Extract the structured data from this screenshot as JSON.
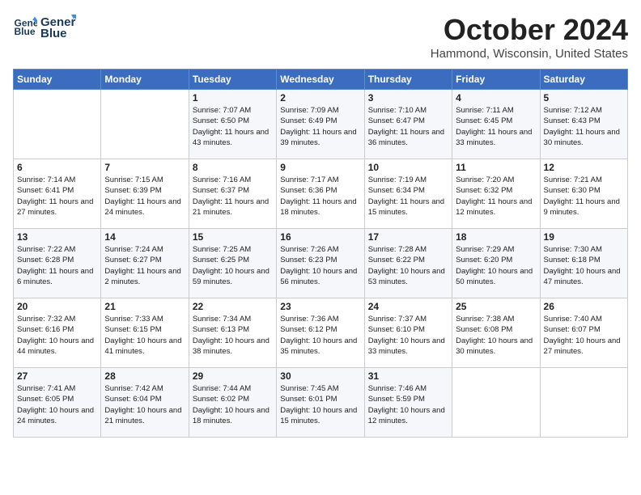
{
  "logo": {
    "line1": "General",
    "line2": "Blue"
  },
  "title": "October 2024",
  "location": "Hammond, Wisconsin, United States",
  "days_header": [
    "Sunday",
    "Monday",
    "Tuesday",
    "Wednesday",
    "Thursday",
    "Friday",
    "Saturday"
  ],
  "weeks": [
    [
      {
        "day": "",
        "sunrise": "",
        "sunset": "",
        "daylight": ""
      },
      {
        "day": "",
        "sunrise": "",
        "sunset": "",
        "daylight": ""
      },
      {
        "day": "1",
        "sunrise": "Sunrise: 7:07 AM",
        "sunset": "Sunset: 6:50 PM",
        "daylight": "Daylight: 11 hours and 43 minutes."
      },
      {
        "day": "2",
        "sunrise": "Sunrise: 7:09 AM",
        "sunset": "Sunset: 6:49 PM",
        "daylight": "Daylight: 11 hours and 39 minutes."
      },
      {
        "day": "3",
        "sunrise": "Sunrise: 7:10 AM",
        "sunset": "Sunset: 6:47 PM",
        "daylight": "Daylight: 11 hours and 36 minutes."
      },
      {
        "day": "4",
        "sunrise": "Sunrise: 7:11 AM",
        "sunset": "Sunset: 6:45 PM",
        "daylight": "Daylight: 11 hours and 33 minutes."
      },
      {
        "day": "5",
        "sunrise": "Sunrise: 7:12 AM",
        "sunset": "Sunset: 6:43 PM",
        "daylight": "Daylight: 11 hours and 30 minutes."
      }
    ],
    [
      {
        "day": "6",
        "sunrise": "Sunrise: 7:14 AM",
        "sunset": "Sunset: 6:41 PM",
        "daylight": "Daylight: 11 hours and 27 minutes."
      },
      {
        "day": "7",
        "sunrise": "Sunrise: 7:15 AM",
        "sunset": "Sunset: 6:39 PM",
        "daylight": "Daylight: 11 hours and 24 minutes."
      },
      {
        "day": "8",
        "sunrise": "Sunrise: 7:16 AM",
        "sunset": "Sunset: 6:37 PM",
        "daylight": "Daylight: 11 hours and 21 minutes."
      },
      {
        "day": "9",
        "sunrise": "Sunrise: 7:17 AM",
        "sunset": "Sunset: 6:36 PM",
        "daylight": "Daylight: 11 hours and 18 minutes."
      },
      {
        "day": "10",
        "sunrise": "Sunrise: 7:19 AM",
        "sunset": "Sunset: 6:34 PM",
        "daylight": "Daylight: 11 hours and 15 minutes."
      },
      {
        "day": "11",
        "sunrise": "Sunrise: 7:20 AM",
        "sunset": "Sunset: 6:32 PM",
        "daylight": "Daylight: 11 hours and 12 minutes."
      },
      {
        "day": "12",
        "sunrise": "Sunrise: 7:21 AM",
        "sunset": "Sunset: 6:30 PM",
        "daylight": "Daylight: 11 hours and 9 minutes."
      }
    ],
    [
      {
        "day": "13",
        "sunrise": "Sunrise: 7:22 AM",
        "sunset": "Sunset: 6:28 PM",
        "daylight": "Daylight: 11 hours and 6 minutes."
      },
      {
        "day": "14",
        "sunrise": "Sunrise: 7:24 AM",
        "sunset": "Sunset: 6:27 PM",
        "daylight": "Daylight: 11 hours and 2 minutes."
      },
      {
        "day": "15",
        "sunrise": "Sunrise: 7:25 AM",
        "sunset": "Sunset: 6:25 PM",
        "daylight": "Daylight: 10 hours and 59 minutes."
      },
      {
        "day": "16",
        "sunrise": "Sunrise: 7:26 AM",
        "sunset": "Sunset: 6:23 PM",
        "daylight": "Daylight: 10 hours and 56 minutes."
      },
      {
        "day": "17",
        "sunrise": "Sunrise: 7:28 AM",
        "sunset": "Sunset: 6:22 PM",
        "daylight": "Daylight: 10 hours and 53 minutes."
      },
      {
        "day": "18",
        "sunrise": "Sunrise: 7:29 AM",
        "sunset": "Sunset: 6:20 PM",
        "daylight": "Daylight: 10 hours and 50 minutes."
      },
      {
        "day": "19",
        "sunrise": "Sunrise: 7:30 AM",
        "sunset": "Sunset: 6:18 PM",
        "daylight": "Daylight: 10 hours and 47 minutes."
      }
    ],
    [
      {
        "day": "20",
        "sunrise": "Sunrise: 7:32 AM",
        "sunset": "Sunset: 6:16 PM",
        "daylight": "Daylight: 10 hours and 44 minutes."
      },
      {
        "day": "21",
        "sunrise": "Sunrise: 7:33 AM",
        "sunset": "Sunset: 6:15 PM",
        "daylight": "Daylight: 10 hours and 41 minutes."
      },
      {
        "day": "22",
        "sunrise": "Sunrise: 7:34 AM",
        "sunset": "Sunset: 6:13 PM",
        "daylight": "Daylight: 10 hours and 38 minutes."
      },
      {
        "day": "23",
        "sunrise": "Sunrise: 7:36 AM",
        "sunset": "Sunset: 6:12 PM",
        "daylight": "Daylight: 10 hours and 35 minutes."
      },
      {
        "day": "24",
        "sunrise": "Sunrise: 7:37 AM",
        "sunset": "Sunset: 6:10 PM",
        "daylight": "Daylight: 10 hours and 33 minutes."
      },
      {
        "day": "25",
        "sunrise": "Sunrise: 7:38 AM",
        "sunset": "Sunset: 6:08 PM",
        "daylight": "Daylight: 10 hours and 30 minutes."
      },
      {
        "day": "26",
        "sunrise": "Sunrise: 7:40 AM",
        "sunset": "Sunset: 6:07 PM",
        "daylight": "Daylight: 10 hours and 27 minutes."
      }
    ],
    [
      {
        "day": "27",
        "sunrise": "Sunrise: 7:41 AM",
        "sunset": "Sunset: 6:05 PM",
        "daylight": "Daylight: 10 hours and 24 minutes."
      },
      {
        "day": "28",
        "sunrise": "Sunrise: 7:42 AM",
        "sunset": "Sunset: 6:04 PM",
        "daylight": "Daylight: 10 hours and 21 minutes."
      },
      {
        "day": "29",
        "sunrise": "Sunrise: 7:44 AM",
        "sunset": "Sunset: 6:02 PM",
        "daylight": "Daylight: 10 hours and 18 minutes."
      },
      {
        "day": "30",
        "sunrise": "Sunrise: 7:45 AM",
        "sunset": "Sunset: 6:01 PM",
        "daylight": "Daylight: 10 hours and 15 minutes."
      },
      {
        "day": "31",
        "sunrise": "Sunrise: 7:46 AM",
        "sunset": "Sunset: 5:59 PM",
        "daylight": "Daylight: 10 hours and 12 minutes."
      },
      {
        "day": "",
        "sunrise": "",
        "sunset": "",
        "daylight": ""
      },
      {
        "day": "",
        "sunrise": "",
        "sunset": "",
        "daylight": ""
      }
    ]
  ]
}
